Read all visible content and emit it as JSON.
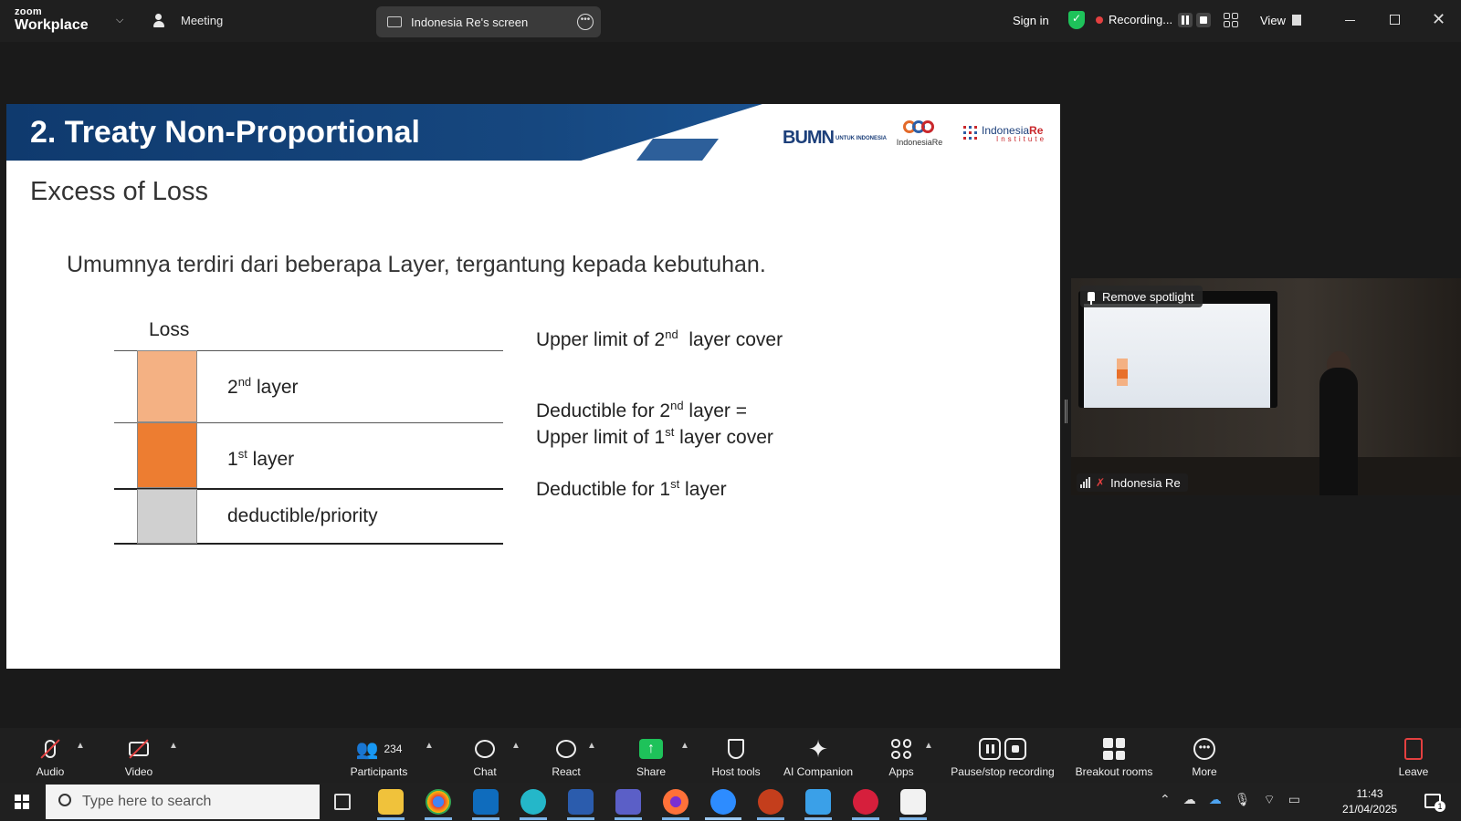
{
  "app": {
    "brand_top": "zoom",
    "brand_bottom": "Workplace",
    "meeting_label": "Meeting",
    "share_pill_label": "Indonesia Re's screen",
    "sign_in": "Sign in",
    "recording_label": "Recording...",
    "view_label": "View"
  },
  "slide": {
    "title": "2. Treaty Non-Proportional",
    "subtitle": "Excess of Loss",
    "lead": "Umumnya terdiri dari beberapa Layer, tergantung kepada kebutuhan.",
    "logos": {
      "bumn": "BUMN",
      "bumn_small": "UNTUK INDONESIA",
      "indonesia_re": "IndonesiaRe",
      "iri_name_a": "Indonesia",
      "iri_name_b": "Re",
      "iri_institute": "Institute"
    },
    "diagram": {
      "axis_label": "Loss",
      "layer2_main": "2",
      "layer2_sup": "nd",
      "layer2_rest": " layer",
      "layer1_main": "1",
      "layer1_sup": "st",
      "layer1_rest": " layer",
      "base_label": "deductible/priority",
      "colors": {
        "layer2": "#F4B183",
        "layer1": "#ED7D31",
        "base": "#D0D0D0"
      }
    },
    "descriptions": {
      "d1_pre": "Upper limit of 2",
      "d1_sup": "nd",
      "d1_post": "  layer cover",
      "d2a_pre": "Deductible for 2",
      "d2a_sup": "nd",
      "d2a_post": " layer =",
      "d2b_pre": "Upper limit of 1",
      "d2b_sup": "st",
      "d2b_post": " layer cover",
      "d3_pre": "Deductible for 1",
      "d3_sup": "st",
      "d3_post": " layer"
    }
  },
  "spotlight": {
    "remove_spotlight": "Remove spotlight",
    "participant_name": "Indonesia Re"
  },
  "toolbar": {
    "audio": "Audio",
    "video": "Video",
    "participants": "Participants",
    "participants_count": "234",
    "chat": "Chat",
    "react": "React",
    "share": "Share",
    "host_tools": "Host tools",
    "ai_companion": "AI Companion",
    "apps": "Apps",
    "pause_stop": "Pause/stop recording",
    "breakout": "Breakout rooms",
    "more": "More",
    "leave": "Leave"
  },
  "taskbar": {
    "search_placeholder": "Type here to search",
    "time": "11:43",
    "date": "21/04/2025",
    "notification_count": "1"
  }
}
